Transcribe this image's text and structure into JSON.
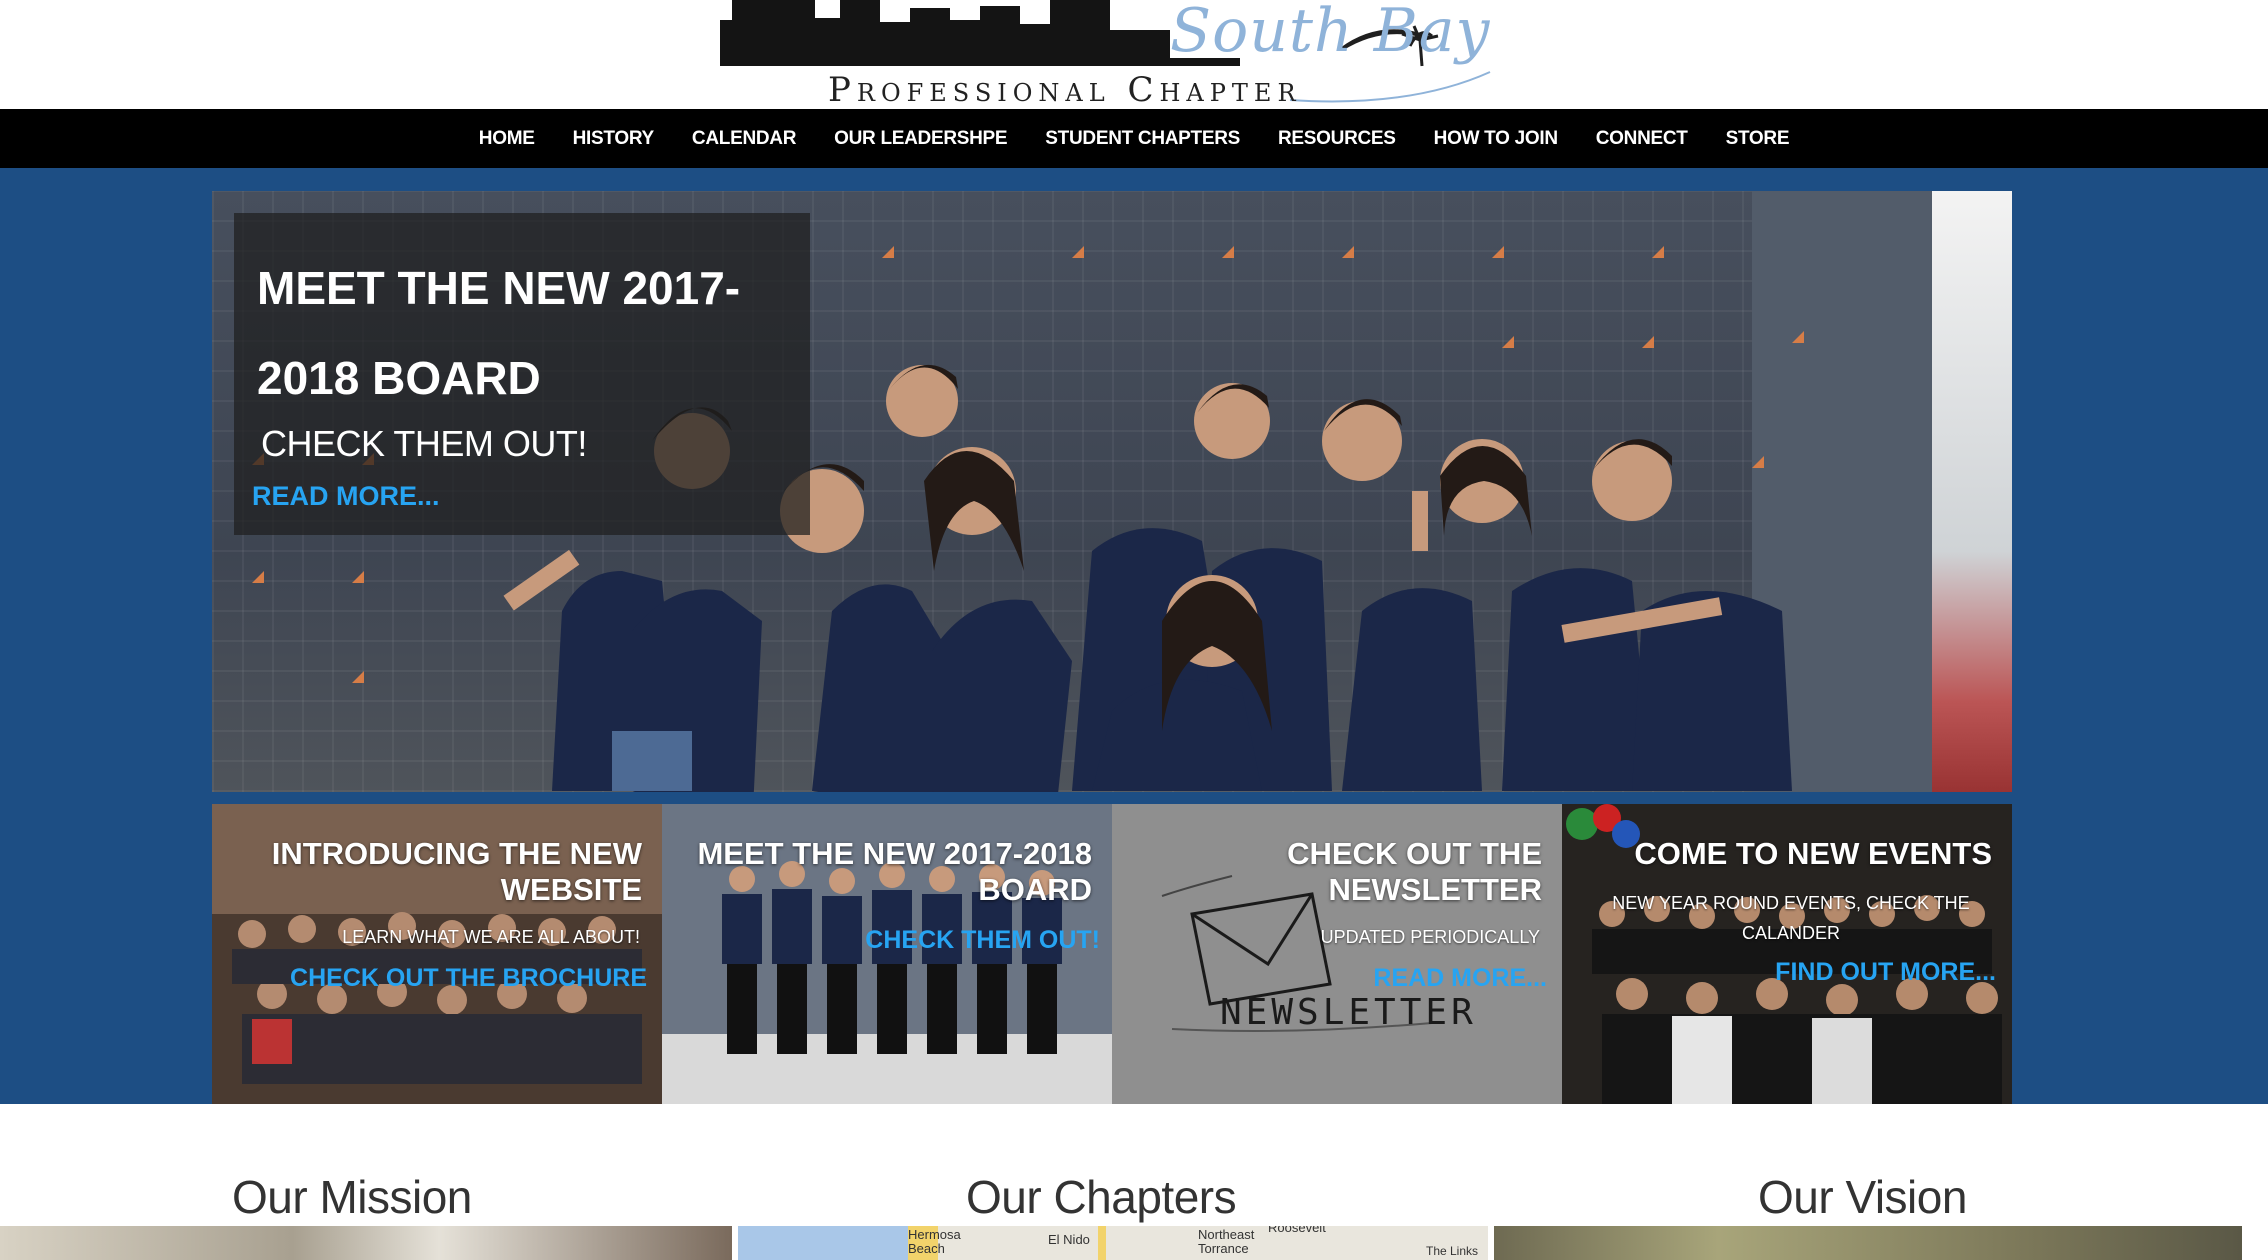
{
  "logo": {
    "script_text": "South Bay",
    "subtitle": "Professional Chapter"
  },
  "nav": {
    "items": [
      "HOME",
      "HISTORY",
      "CALENDAR",
      "OUR LEADERSHPE",
      "STUDENT CHAPTERS",
      "RESOURCES",
      "HOW TO JOIN",
      "CONNECT",
      "STORE"
    ]
  },
  "hero": {
    "title": "MEET THE NEW 2017-2018 BOARD",
    "subtitle": "CHECK THEM OUT!",
    "link": "READ MORE..."
  },
  "tiles": [
    {
      "title": "INTRODUCING THE NEW WEBSITE",
      "sub": "LEARN WHAT WE ARE ALL ABOUT!",
      "link": "CHECK OUT THE BROCHURE"
    },
    {
      "title": "MEET THE NEW 2017-2018 BOARD",
      "sub": "",
      "link": "CHECK THEM OUT!"
    },
    {
      "title": "CHECK OUT THE NEWSLETTER",
      "sub": "UPDATED PERIODICALLY",
      "link": "READ MORE...",
      "image_text": "NEWSLETTER"
    },
    {
      "title": "COME TO NEW EVENTS",
      "sub": "NEW YEAR ROUND EVENTS, CHECK THE CALANDER",
      "link": "FIND OUT MORE..."
    }
  ],
  "sections": {
    "mission": "Our Mission",
    "chapters": "Our Chapters",
    "vision": "Our Vision"
  },
  "map_labels": [
    "Hermosa Beach",
    "El Nido",
    "Northeast Torrance",
    "Roosevelt",
    "The Links"
  ],
  "colors": {
    "nav_bg": "#000000",
    "band_bg": "#1d4e84",
    "link_blue": "#27a4f2",
    "logo_script": "#8fb3d9"
  }
}
